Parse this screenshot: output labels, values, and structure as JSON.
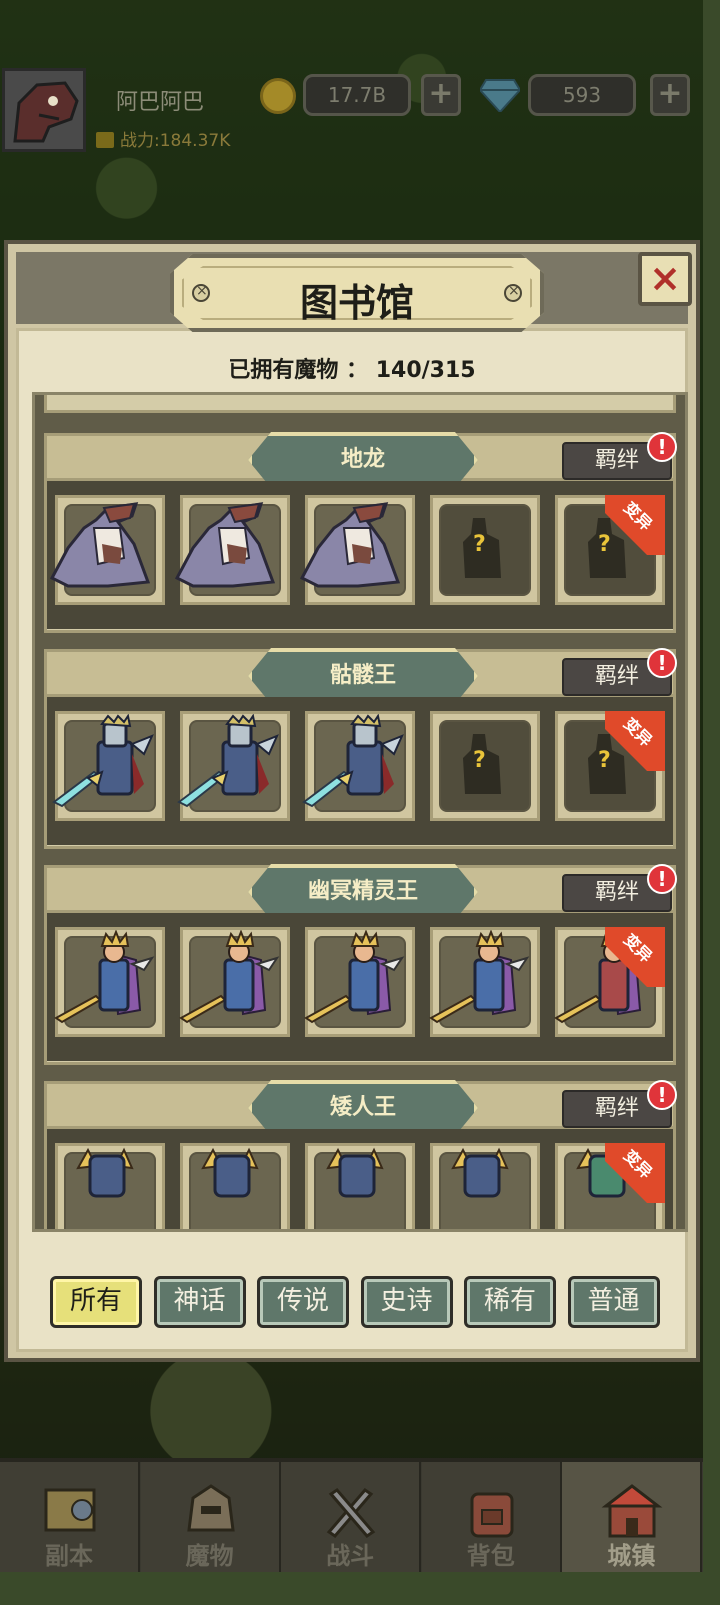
{
  "hud": {
    "player_name": "阿巴阿巴",
    "power": "战力:184.37K",
    "gold": "17.7B",
    "gems": "593",
    "plus": "+"
  },
  "library": {
    "title": "图书馆",
    "close": "×",
    "owned_label": "已拥有魔物 ： 140/315",
    "bond_label": "羁绊",
    "alert": "!",
    "mutation_label": "变异",
    "locked_mark": "?",
    "groups": [
      {
        "name": "地龙",
        "monster": "earth-dragon",
        "cards": [
          "owned",
          "owned",
          "owned",
          "locked",
          "locked-mutation"
        ]
      },
      {
        "name": "骷髅王",
        "monster": "skeleton-king",
        "cards": [
          "owned",
          "owned",
          "owned",
          "locked",
          "locked-mutation"
        ]
      },
      {
        "name": "幽冥精灵王",
        "monster": "nether-elf-king",
        "cards": [
          "owned",
          "owned",
          "owned",
          "owned",
          "owned-mutation"
        ]
      },
      {
        "name": "矮人王",
        "monster": "dwarf-king",
        "cards": [
          "owned",
          "owned",
          "owned",
          "owned",
          "owned-mutation"
        ]
      }
    ]
  },
  "filters": [
    {
      "label": "所有",
      "active": true
    },
    {
      "label": "神话",
      "active": false
    },
    {
      "label": "传说",
      "active": false
    },
    {
      "label": "史诗",
      "active": false
    },
    {
      "label": "稀有",
      "active": false
    },
    {
      "label": "普通",
      "active": false
    }
  ],
  "nav": [
    {
      "label": "副本",
      "icon": "map-icon",
      "active": false
    },
    {
      "label": "魔物",
      "icon": "helmet-icon",
      "active": false
    },
    {
      "label": "战斗",
      "icon": "swords-icon",
      "active": false
    },
    {
      "label": "背包",
      "icon": "backpack-icon",
      "active": false
    },
    {
      "label": "城镇",
      "icon": "town-icon",
      "active": true
    }
  ],
  "colors": {
    "accent_green": "#5f776a",
    "active_filter": "#e6e07a",
    "alert_red": "#e0343a",
    "mutation_red": "#e04a2a",
    "close_red": "#b0302a"
  }
}
